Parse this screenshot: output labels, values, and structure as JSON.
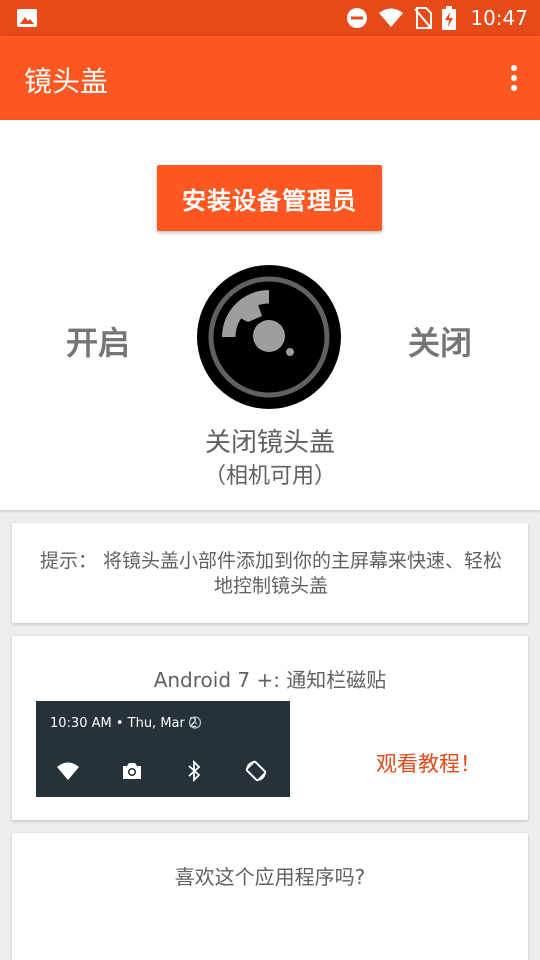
{
  "status_bar": {
    "time": "10:47",
    "icons": [
      "gallery-icon",
      "do-not-disturb-icon",
      "wifi-icon",
      "no-sim-icon",
      "battery-charging-icon"
    ]
  },
  "app_bar": {
    "title": "镜头盖",
    "menu_icon": "more-vert-icon"
  },
  "main": {
    "admin_button_label": "安装设备管理员",
    "on_label": "开启",
    "off_label": "关闭",
    "status": "关闭镜头盖",
    "substatus": "（相机可用）"
  },
  "tip": {
    "text": "提示： 将镜头盖小部件添加到你的主屏幕来快速、轻松地控制镜头盖"
  },
  "tile": {
    "title": "Android 7 +: 通知栏磁贴",
    "preview_time": "10:30 AM • Thu, Mar 2",
    "preview_icons": [
      "wifi-icon",
      "camera-icon",
      "bluetooth-icon",
      "rotate-icon"
    ],
    "watch_label": "观看教程！"
  },
  "rate": {
    "question": "喜欢这个应用程序吗?"
  },
  "colors": {
    "status_bar": "#e64a19",
    "app_bar": "#ff5722",
    "accent": "#ff5722",
    "tile_preview_bg": "#263238"
  }
}
